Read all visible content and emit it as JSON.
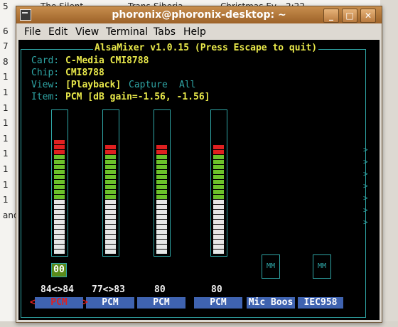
{
  "background_window": {
    "rows": [
      {
        "num": "5",
        "title": "The Silent",
        "artist": "Trans-Siberia",
        "album": "Christmas Ev",
        "time": "2:22"
      },
      {
        "num": "6",
        "title": "",
        "artist": "",
        "album": "",
        "time": ""
      },
      {
        "num": "7",
        "title": "",
        "artist": "",
        "album": "",
        "time": ""
      },
      {
        "num": "8",
        "title": "",
        "artist": "",
        "album": "",
        "time": ""
      },
      {
        "num": "1",
        "title": "",
        "artist": "",
        "album": "",
        "time": ""
      },
      {
        "num": "1",
        "title": "",
        "artist": "",
        "album": "",
        "time": ""
      },
      {
        "num": "1",
        "title": "",
        "artist": "",
        "album": "",
        "time": ""
      },
      {
        "num": "1",
        "title": "",
        "artist": "",
        "album": "",
        "time": ""
      },
      {
        "num": "1",
        "title": "",
        "artist": "",
        "album": "",
        "time": ""
      },
      {
        "num": "1",
        "title": "",
        "artist": "",
        "album": "",
        "time": ""
      },
      {
        "num": "1",
        "title": "",
        "artist": "",
        "album": "",
        "time": ""
      },
      {
        "num": "1",
        "title": "",
        "artist": "",
        "album": "",
        "time": ""
      },
      {
        "num": "1",
        "title": "",
        "artist": "",
        "album": "",
        "time": ""
      },
      {
        "num": "and",
        "title": "",
        "artist": "",
        "album": "",
        "time": ""
      }
    ]
  },
  "window": {
    "title": "phoronix@phoronix-desktop: ~",
    "minimize_symbol": "_",
    "maximize_symbol": "□",
    "close_symbol": "✕"
  },
  "menu": [
    "File",
    "Edit",
    "View",
    "Terminal",
    "Tabs",
    "Help"
  ],
  "alsamixer": {
    "header": "AlsaMixer v1.0.15 (Press Escape to quit)",
    "card_label": "Card:",
    "card_value": "C-Media CMI8788",
    "chip_label": "Chip:",
    "chip_value": "CMI8788",
    "view_label": "View:",
    "view_playback": "[Playback]",
    "view_capture": "Capture",
    "view_all": "All",
    "item_label": "Item:",
    "item_value": "PCM [dB gain=-1.56, -1.56]",
    "mute_state": "00",
    "mm_label": "MM",
    "left_arrow": "<",
    "right_arrow": ">",
    "side_arrows": [
      ">",
      ">",
      ">",
      ">",
      ">",
      ">",
      ">"
    ],
    "channels": [
      {
        "volume": "84<>84",
        "label": "PCM",
        "level": 0.84,
        "selected": true
      },
      {
        "volume": "77<>83",
        "label": "PCM",
        "level": 0.8,
        "selected": false
      },
      {
        "volume": "80",
        "label": "PCM",
        "level": 0.8,
        "selected": false
      },
      {
        "volume": "80",
        "label": "PCM",
        "level": 0.8,
        "selected": false
      },
      {
        "volume": "",
        "label": "Mic Boos",
        "level": 0,
        "selected": false
      },
      {
        "volume": "",
        "label": "IEC958",
        "level": 0,
        "selected": false
      }
    ]
  },
  "colors": {
    "frame": "#2fa6a6",
    "header": "#d8d838",
    "bar_white": "#e6e6e6",
    "bar_green": "#6bc22a",
    "bar_red": "#e02020",
    "label_bg": "#3f63b0",
    "selected_label": "#e02020"
  }
}
